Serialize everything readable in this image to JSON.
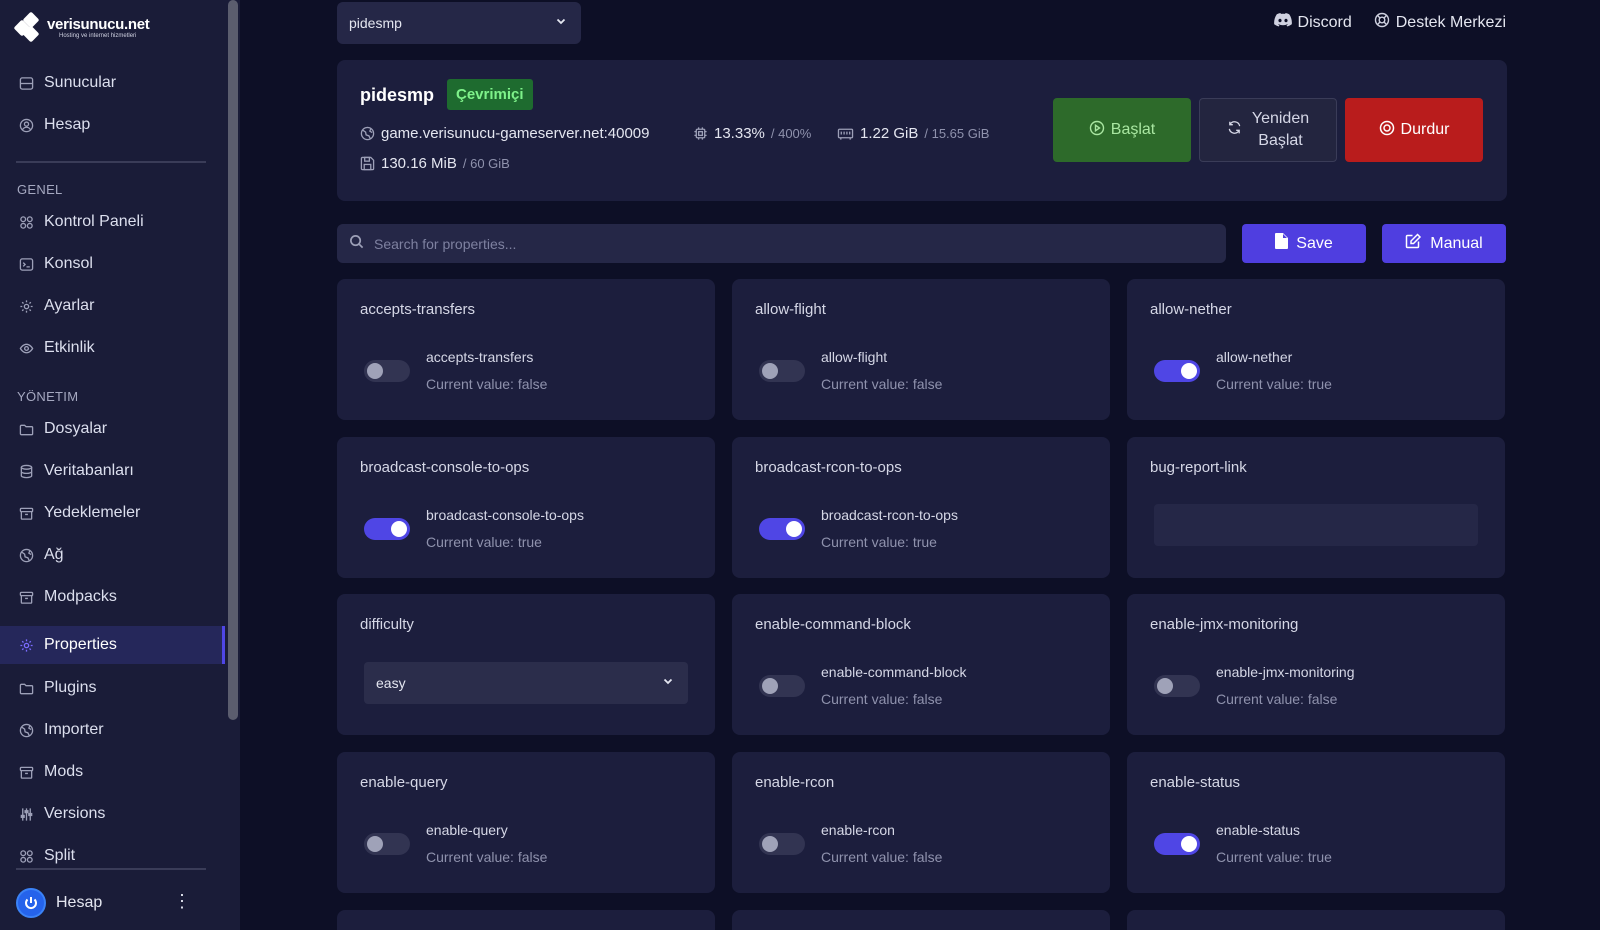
{
  "brand": {
    "name": "verisunucu.net",
    "tagline": "Hosting ve internet hizmetleri"
  },
  "sidebar": {
    "top_items": [
      {
        "label": "Sunucular",
        "icon": "server-icon"
      },
      {
        "label": "Hesap",
        "icon": "user-circle-icon"
      }
    ],
    "sections": [
      {
        "label": "GENEL",
        "items": [
          {
            "label": "Kontrol Paneli",
            "icon": "grid-icon"
          },
          {
            "label": "Konsol",
            "icon": "terminal-icon"
          },
          {
            "label": "Ayarlar",
            "icon": "gear-icon"
          },
          {
            "label": "Etkinlik",
            "icon": "eye-icon"
          }
        ]
      },
      {
        "label": "YÖNETIM",
        "items": [
          {
            "label": "Dosyalar",
            "icon": "folder-icon"
          },
          {
            "label": "Veritabanları",
            "icon": "database-icon"
          },
          {
            "label": "Yedeklemeler",
            "icon": "archive-icon"
          },
          {
            "label": "Ağ",
            "icon": "network-icon"
          },
          {
            "label": "Modpacks",
            "icon": "archive-icon"
          },
          {
            "label": "Properties",
            "icon": "gear-icon",
            "active": true
          },
          {
            "label": "Plugins",
            "icon": "folder-icon"
          },
          {
            "label": "Importer",
            "icon": "network-icon"
          },
          {
            "label": "Mods",
            "icon": "archive-icon"
          },
          {
            "label": "Versions",
            "icon": "sliders-icon"
          },
          {
            "label": "Split",
            "icon": "grid-icon"
          }
        ]
      }
    ],
    "account": {
      "label": "Hesap"
    }
  },
  "topbar": {
    "server_select": {
      "value": "pidesmp"
    },
    "links": [
      {
        "label": "Discord",
        "icon": "discord-icon"
      },
      {
        "label": "Destek Merkezi",
        "icon": "support-icon"
      }
    ]
  },
  "server": {
    "name": "pidesmp",
    "status": "Çevrimiçi",
    "address": "game.verisunucu-gameserver.net:40009",
    "cpu": "13.33%",
    "cpu_limit": "/ 400%",
    "memory": "1.22 GiB",
    "memory_limit": "/ 15.65 GiB",
    "disk": "130.16 MiB",
    "disk_limit": "/ 60 GiB",
    "buttons": {
      "start": "Başlat",
      "restart_line1": "Yeniden",
      "restart_line2": "Başlat",
      "stop": "Durdur"
    }
  },
  "toolbar": {
    "search_placeholder": "Search for properties...",
    "save_label": "Save",
    "manual_label": "Manual"
  },
  "colors": {
    "accent": "#4f46e5",
    "start": "#2d6a2a",
    "stop": "#b91c1c",
    "online": "#1e6b2f"
  },
  "properties": [
    {
      "title": "accepts-transfers",
      "type": "toggle",
      "key": "accepts-transfers",
      "on": false,
      "current": "Current value: false"
    },
    {
      "title": "allow-flight",
      "type": "toggle",
      "key": "allow-flight",
      "on": false,
      "current": "Current value: false"
    },
    {
      "title": "allow-nether",
      "type": "toggle",
      "key": "allow-nether",
      "on": true,
      "current": "Current value: true"
    },
    {
      "title": "broadcast-console-to-ops",
      "type": "toggle",
      "key": "broadcast-console-to-ops",
      "on": true,
      "current": "Current value: true"
    },
    {
      "title": "broadcast-rcon-to-ops",
      "type": "toggle",
      "key": "broadcast-rcon-to-ops",
      "on": true,
      "current": "Current value: true"
    },
    {
      "title": "bug-report-link",
      "type": "text",
      "value": ""
    },
    {
      "title": "difficulty",
      "type": "select",
      "value": "easy"
    },
    {
      "title": "enable-command-block",
      "type": "toggle",
      "key": "enable-command-block",
      "on": false,
      "current": "Current value: false"
    },
    {
      "title": "enable-jmx-monitoring",
      "type": "toggle",
      "key": "enable-jmx-monitoring",
      "on": false,
      "current": "Current value: false"
    },
    {
      "title": "enable-query",
      "type": "toggle",
      "key": "enable-query",
      "on": false,
      "current": "Current value: false"
    },
    {
      "title": "enable-rcon",
      "type": "toggle",
      "key": "enable-rcon",
      "on": false,
      "current": "Current value: false"
    },
    {
      "title": "enable-status",
      "type": "toggle",
      "key": "enable-status",
      "on": true,
      "current": "Current value: true"
    }
  ]
}
